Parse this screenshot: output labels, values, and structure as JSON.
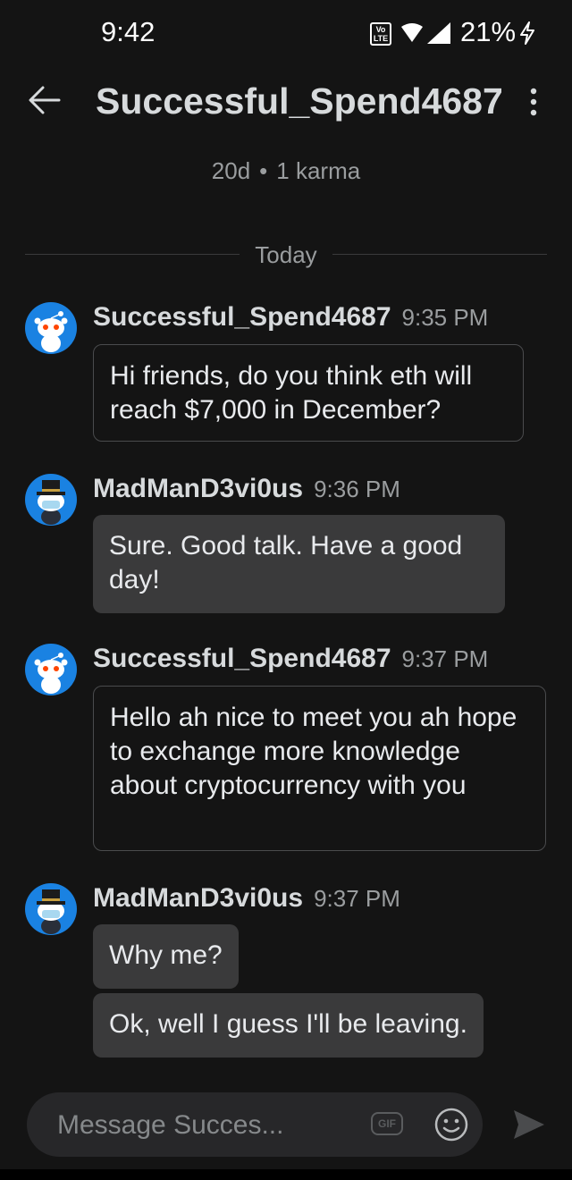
{
  "status_bar": {
    "time": "9:42",
    "volte": "Vo LTE",
    "battery": "21%"
  },
  "header": {
    "title": "Successful_Spend4687",
    "account_age": "20d",
    "separator": "•",
    "karma": "1 karma"
  },
  "day_divider": "Today",
  "messages": [
    {
      "author": "Successful_Spend4687",
      "time": "9:35 PM",
      "texts": [
        "Hi friends, do you think eth will reach $7,000 in December?"
      ]
    },
    {
      "author": "MadManD3vi0us",
      "time": "9:36 PM",
      "texts": [
        "Sure. Good talk. Have a good day!"
      ]
    },
    {
      "author": "Successful_Spend4687",
      "time": "9:37 PM",
      "texts": [
        "Hello ah nice to meet you ah hope to exchange more knowledge about cryptocurrency with you"
      ]
    },
    {
      "author": "MadManD3vi0us",
      "time": "9:37 PM",
      "texts": [
        "Why me?",
        "Ok, well I guess I'll be leaving."
      ]
    }
  ],
  "composer": {
    "placeholder": "Message Succes...",
    "gif_label": "GIF"
  },
  "icons": {
    "back": "arrow-left-icon",
    "more": "more-vertical-icon",
    "emoji": "emoji-icon",
    "send": "send-icon",
    "gif": "gif-icon",
    "wifi": "wifi-icon",
    "signal": "signal-icon",
    "bolt": "charging-bolt-icon"
  },
  "colors": {
    "background": "#141414",
    "bubble_filled": "#3a3a3b",
    "bubble_outline": "#4a4b4d",
    "avatar_bg": "#1a82e2",
    "muted_text": "#9a9d9f"
  }
}
